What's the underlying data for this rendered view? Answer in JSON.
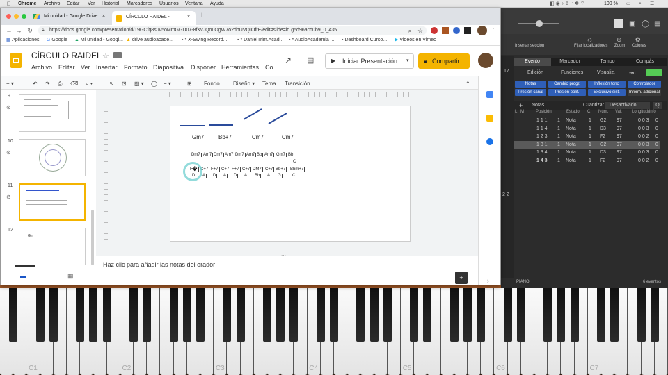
{
  "menubar": {
    "apple": "",
    "app": "Chrome",
    "items": [
      "Archivo",
      "Editar",
      "Ver",
      "Historial",
      "Marcadores",
      "Usuarios",
      "Ventana",
      "Ayuda"
    ],
    "battery": "100 %"
  },
  "browser": {
    "tabs": [
      {
        "label": "Mi unidad - Google Drive"
      },
      {
        "label": "CÍRCULO RAIDEL - Presentació"
      }
    ],
    "url": "https://docs.google.com/presentation/d/19GCfq8suv5oMmGGD07-8fKvJQouOgW7o2dhUVQIOfrE/edit#slide=id.g5d96acd0b9_0_435",
    "bookmarks": [
      "Aplicaciones",
      "Google",
      "Mi unidad - Googl...",
      "drive audioacade...",
      "* X-Swing Record...",
      "* DanielTrim.Acad...",
      "* AudioAcademia |...",
      "Dashboard Curso...",
      "Videos en Vimeo"
    ]
  },
  "slides": {
    "title": "CÍRCULO RAIDEL",
    "menus": [
      "Archivo",
      "Editar",
      "Ver",
      "Insertar",
      "Formato",
      "Diapositiva",
      "Disponer",
      "Herramientas",
      "Co"
    ],
    "present_label": "Iniciar Presentación",
    "share_label": "Compartir",
    "toolbar": {
      "fondo": "Fondo...",
      "diseno": "Diseño",
      "tema": "Tema",
      "transicion": "Transición"
    },
    "thumbs": [
      "9",
      "10",
      "11",
      "12"
    ],
    "thumb12_text": "Gm",
    "notes_placeholder": "Haz clic para añadir las notas del orador",
    "chords": [
      "Gm7",
      "Bb+7",
      "Cm7",
      "Cm7"
    ],
    "row1": [
      "Dm7",
      "Am7",
      "Dm7",
      "Am7",
      "Dm7",
      "Am7",
      "Bb",
      "Am7",
      "Gm7",
      "Bb"
    ],
    "row1_sub": "C",
    "row2": [
      "F+7",
      "C+7",
      "F+7",
      "C+7",
      "F+7",
      "C+7",
      "DM7",
      "C+7",
      "Bb+7",
      "Bbm+7"
    ],
    "row3": [
      "D",
      "A",
      "D",
      "A",
      "D",
      "A",
      "Bb",
      "A",
      "G",
      "C"
    ]
  },
  "logic": {
    "top_labels": [
      "Insertar sección",
      "Fijar localizadores",
      "Zoom",
      "Colores"
    ],
    "tabs": [
      "Evento",
      "Marcador",
      "Tempo",
      "Compás"
    ],
    "num17": "17",
    "edit_menus": [
      "Edición",
      "Funciones",
      "Visualiz."
    ],
    "filter_buttons": [
      "Notas",
      "Cambio progr.",
      "Inflexión tono",
      "Controlador",
      "Presión canal",
      "Presión polif.",
      "Exclusivo sist.",
      "Inform. adicional"
    ],
    "notas_label": "Notas",
    "cuantizar_label": "Cuantizar",
    "cuantizar_value": "Desactivado",
    "q_label": "Q",
    "headers": [
      "L",
      "M",
      "Posición",
      "Estado",
      "C.",
      "Núm.",
      "Val.",
      "Longitud/Info"
    ],
    "rows": [
      {
        "pos": "1 1 1",
        "b": "1",
        "st": "Nota",
        "c": "1",
        "num": "G2",
        "val": "97",
        "len": "0 0 3",
        "l": "0"
      },
      {
        "pos": "1 1 4",
        "b": "1",
        "st": "Nota",
        "c": "1",
        "num": "D3",
        "val": "97",
        "len": "0 0 3",
        "l": "0"
      },
      {
        "pos": "1 2 3",
        "b": "1",
        "st": "Nota",
        "c": "1",
        "num": "F2",
        "val": "97",
        "len": "0 0 2",
        "l": "0"
      },
      {
        "pos": "1 3 1",
        "b": "1",
        "st": "Nota",
        "c": "1",
        "num": "G2",
        "val": "97",
        "len": "0 0 3",
        "l": "0"
      },
      {
        "pos": "1 3 4",
        "b": "1",
        "st": "Nota",
        "c": "1",
        "num": "D3",
        "val": "97",
        "len": "0 0 3",
        "l": "0"
      },
      {
        "pos": "1 4 3",
        "b": "1",
        "st": "Nota",
        "c": "1",
        "num": "F2",
        "val": "97",
        "len": "0 0 2",
        "l": "0"
      }
    ],
    "side_num": "2 2",
    "footer_left": "PIANO",
    "footer_right": "6 eventos"
  },
  "piano": {
    "labels": [
      "C1",
      "C2",
      "C3",
      "C4",
      "C5",
      "C6",
      "C7"
    ]
  }
}
